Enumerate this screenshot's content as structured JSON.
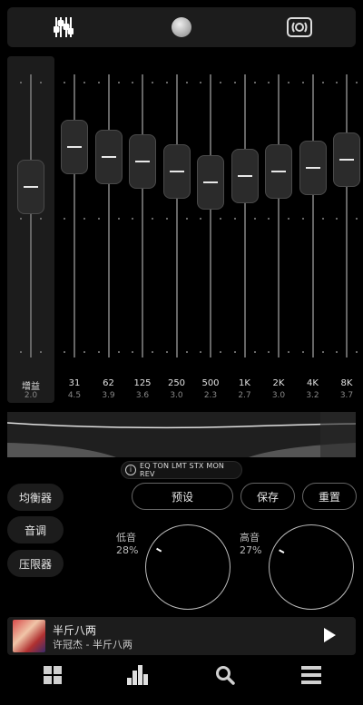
{
  "toolbar": {
    "items": [
      {
        "name": "equalizer-tab-icon"
      },
      {
        "name": "tone-tab-icon"
      },
      {
        "name": "surround-tab-icon"
      }
    ]
  },
  "gain": {
    "label": "增益",
    "value": "2.0",
    "level_db": 2.0
  },
  "bands": [
    {
      "label": "31",
      "value": "4.5",
      "db": 4.5
    },
    {
      "label": "62",
      "value": "3.9",
      "db": 3.9
    },
    {
      "label": "125",
      "value": "3.6",
      "db": 3.6
    },
    {
      "label": "250",
      "value": "3.0",
      "db": 3.0
    },
    {
      "label": "500",
      "value": "2.3",
      "db": 2.3
    },
    {
      "label": "1K",
      "value": "2.7",
      "db": 2.7
    },
    {
      "label": "2K",
      "value": "3.0",
      "db": 3.0
    },
    {
      "label": "4K",
      "value": "3.2",
      "db": 3.2
    },
    {
      "label": "8K",
      "value": "3.7",
      "db": 3.7
    }
  ],
  "modules": {
    "text": "EQ TON LMT STX MON REV",
    "icon": "i"
  },
  "side_buttons": [
    "均衡器",
    "音调",
    "压限器"
  ],
  "actions": {
    "preset": "预设",
    "save": "保存",
    "reset": "重置"
  },
  "bass": {
    "label": "低音",
    "value": "28%",
    "percent": 28
  },
  "treble": {
    "label": "高音",
    "value": "27%",
    "percent": 27
  },
  "now_playing": {
    "title": "半斤八两",
    "subtitle": "许冠杰 - 半斤八两"
  },
  "nav": [
    {
      "name": "grid-icon"
    },
    {
      "name": "bar-chart-icon"
    },
    {
      "name": "search-icon"
    },
    {
      "name": "menu-icon"
    }
  ],
  "colors": {
    "background": "#000000",
    "panel": "#1c1c1c",
    "accent": "#ffffff"
  }
}
